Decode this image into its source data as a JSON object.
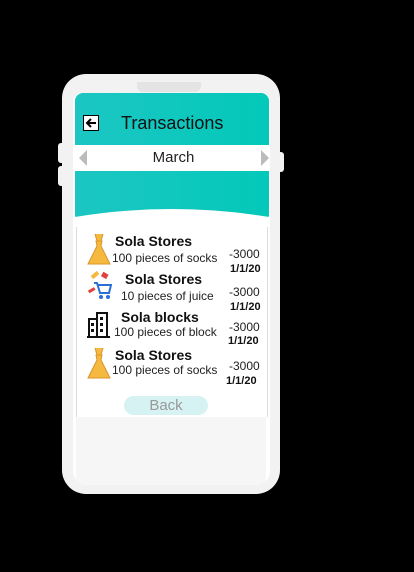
{
  "header": {
    "title": "Transactions"
  },
  "month_selector": {
    "month": "March"
  },
  "transactions": [
    {
      "name": "Sola Stores",
      "description": "100 pieces of socks",
      "amount": "-3000",
      "date": "1/1/20",
      "icon": "dress-icon"
    },
    {
      "name": "Sola Stores",
      "description": "10 pieces of juice",
      "amount": "-3000",
      "date": "1/1/20",
      "icon": "shopping-cart-icon"
    },
    {
      "name": "Sola blocks",
      "description": "100 pieces of block",
      "amount": "-3000",
      "date": "1/1/20",
      "icon": "building-icon"
    },
    {
      "name": "Sola Stores",
      "description": "100 pieces of socks",
      "amount": "-3000",
      "date": "1/1/20",
      "icon": "dress-icon"
    }
  ],
  "footer": {
    "back_label": "Back"
  },
  "colors": {
    "accent": "#1cc6c3",
    "dress": "#f5b940",
    "button_bg": "#d6f2f3"
  }
}
